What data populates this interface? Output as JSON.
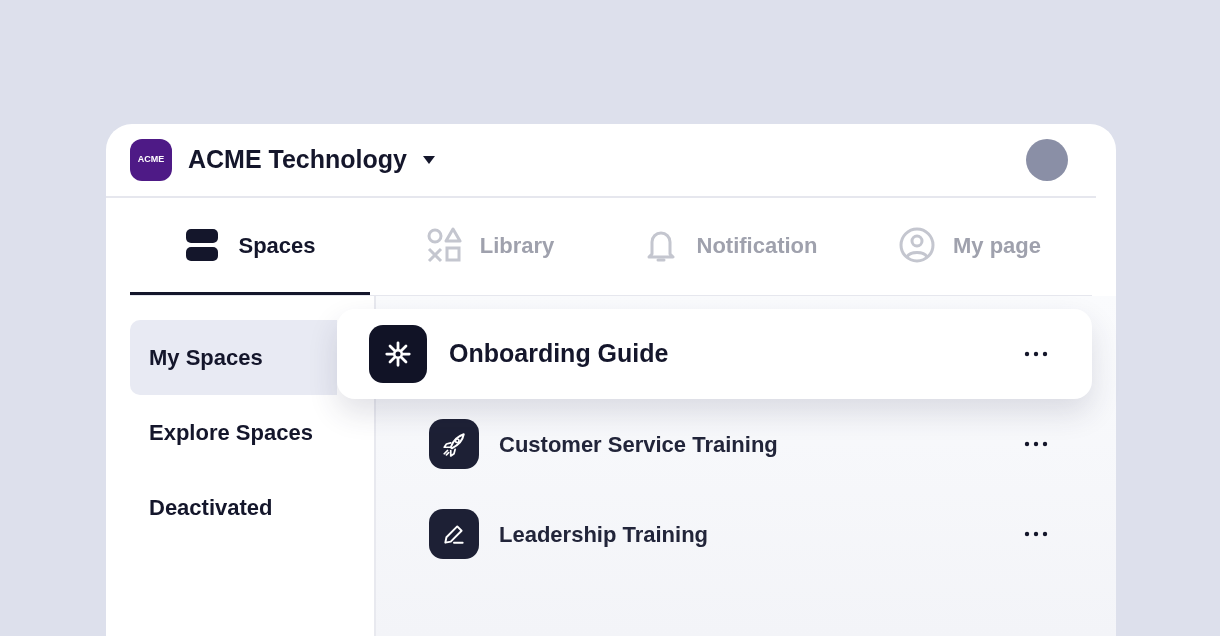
{
  "workspace": {
    "logo_text": "ACME",
    "name": "ACME Technology"
  },
  "tabs": [
    {
      "label": "Spaces",
      "selected": true
    },
    {
      "label": "Library",
      "selected": false
    },
    {
      "label": "Notification",
      "selected": false
    },
    {
      "label": "My page",
      "selected": false
    }
  ],
  "sidebar": {
    "items": [
      {
        "label": "My Spaces",
        "selected": true
      },
      {
        "label": "Explore Spaces",
        "selected": false
      },
      {
        "label": "Deactivated",
        "selected": false
      }
    ]
  },
  "spaces": [
    {
      "title": "Onboarding Guide",
      "selected": true
    },
    {
      "title": "Customer Service Training",
      "selected": false
    },
    {
      "title": "Leadership Training",
      "selected": false
    }
  ]
}
